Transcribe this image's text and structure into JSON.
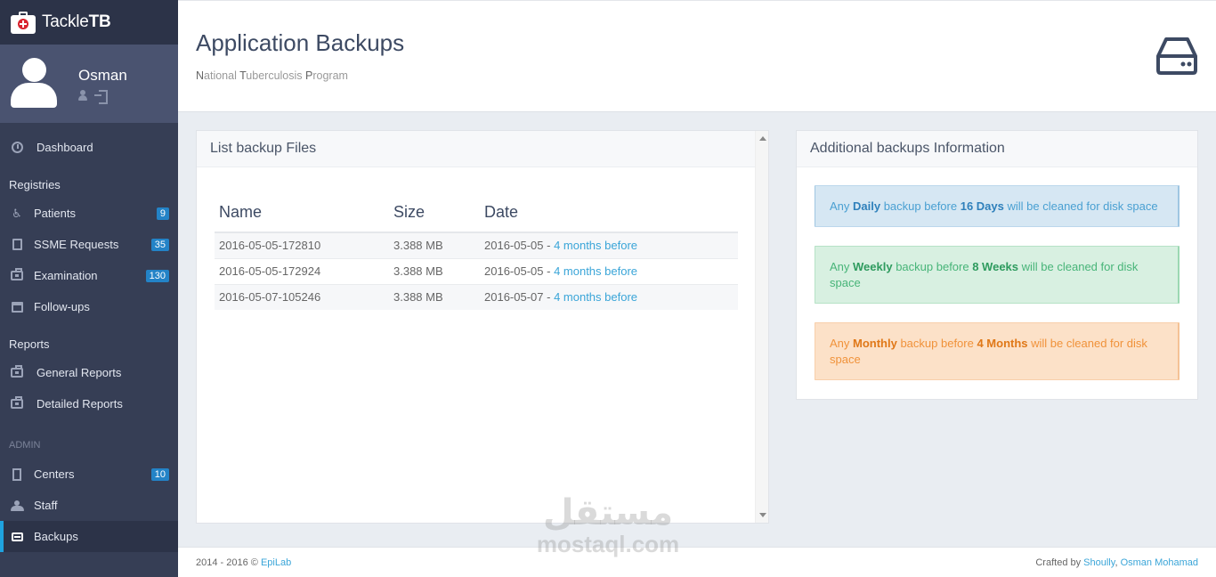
{
  "brand": {
    "name_regular": "Tackle",
    "name_bold": "TB"
  },
  "user": {
    "name": "Osman"
  },
  "sidebar": {
    "dashboard": "Dashboard",
    "registries_header": "Registries",
    "patients": {
      "label": "Patients",
      "badge": "9"
    },
    "ssme": {
      "label": "SSME Requests",
      "badge": "35"
    },
    "examination": {
      "label": "Examination",
      "badge": "130"
    },
    "followups": {
      "label": "Follow-ups"
    },
    "reports_header": "Reports",
    "general_reports": "General Reports",
    "detailed_reports": "Detailed Reports",
    "admin_header": "ADMIN",
    "centers": {
      "label": "Centers",
      "badge": "10"
    },
    "staff": "Staff",
    "backups": "Backups"
  },
  "header": {
    "title": "Application Backups",
    "subtitle_parts": [
      "N",
      "ational ",
      "T",
      "uberculosis ",
      "P",
      "rogram"
    ]
  },
  "list_panel": {
    "title": "List backup Files",
    "columns": [
      "Name",
      "Size",
      "Date"
    ],
    "rows": [
      {
        "name": "2016-05-05-172810",
        "size": "3.388 MB",
        "date": "2016-05-05",
        "relative": "4 months before"
      },
      {
        "name": "2016-05-05-172924",
        "size": "3.388 MB",
        "date": "2016-05-05",
        "relative": "4 months before"
      },
      {
        "name": "2016-05-07-105246",
        "size": "3.388 MB",
        "date": "2016-05-07",
        "relative": "4 months before"
      }
    ]
  },
  "info_panel": {
    "title": "Additional backups Information",
    "daily": {
      "pre": "Any ",
      "kind": "Daily",
      "mid": " backup before ",
      "period": "16 Days",
      "post": " will be cleaned for disk space"
    },
    "weekly": {
      "pre": "Any ",
      "kind": "Weekly",
      "mid": " backup before ",
      "period": "8 Weeks",
      "post": " will be cleaned for disk space"
    },
    "monthly": {
      "pre": "Any ",
      "kind": "Monthly",
      "mid": " backup before ",
      "period": "4 Months",
      "post": " will be cleaned for disk space"
    }
  },
  "footer": {
    "left_text": "2014 - 2016 © ",
    "left_link": "EpiLab",
    "right_text": "Crafted by ",
    "right_link1": "Shoully",
    "right_sep": ", ",
    "right_link2": "Osman Mohamad"
  },
  "watermark": {
    "arabic": "مستقل",
    "latin": "mostaql.com"
  },
  "colors": {
    "sidebar": "#363e55",
    "accent": "#1fa3e0",
    "badge": "#2383c7",
    "link": "#3aa5d8"
  }
}
